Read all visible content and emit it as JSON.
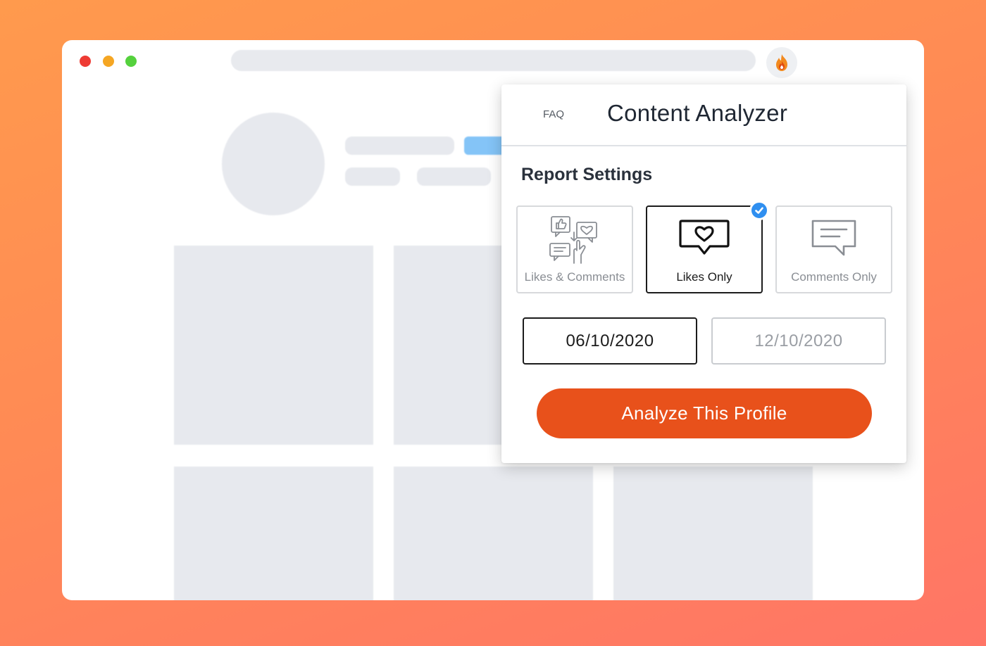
{
  "popup": {
    "faq_label": "FAQ",
    "title": "Content Analyzer",
    "section_title": "Report Settings",
    "options": [
      {
        "label": "Likes & Comments",
        "icon": "likes-comments-icon",
        "selected": false
      },
      {
        "label": "Likes Only",
        "icon": "heart-speech-bubble-icon",
        "selected": true
      },
      {
        "label": "Comments Only",
        "icon": "comment-bubble-icon",
        "selected": false
      }
    ],
    "start_date": "06/10/2020",
    "end_date": "12/10/2020",
    "analyze_button": "Analyze This Profile"
  },
  "colors": {
    "accent": "#e8511b",
    "check": "#2f8ff0",
    "background_gradient": [
      "#ff9a4d",
      "#ff7566"
    ]
  }
}
